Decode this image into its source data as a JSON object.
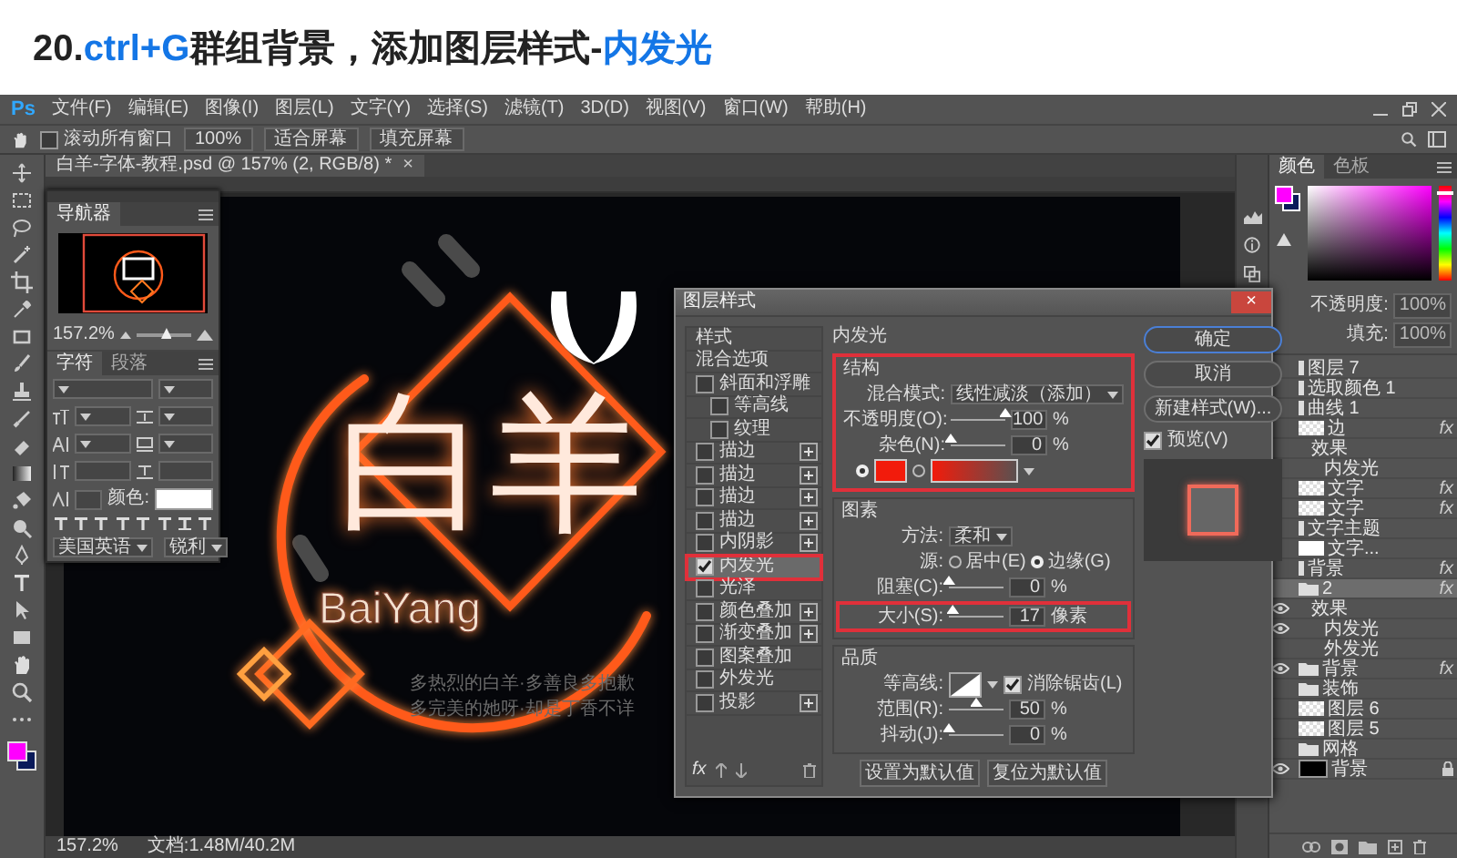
{
  "title": {
    "segments": [
      {
        "text": "20.",
        "highlight": false
      },
      {
        "text": "ctrl+G",
        "highlight": true
      },
      {
        "text": "群组背景，添加图层样式-",
        "highlight": false
      },
      {
        "text": "内发光",
        "highlight": true
      }
    ]
  },
  "app": {
    "logo": "Ps",
    "menu": [
      "文件(F)",
      "编辑(E)",
      "图像(I)",
      "图层(L)",
      "文字(Y)",
      "选择(S)",
      "滤镜(T)",
      "3D(D)",
      "视图(V)",
      "窗口(W)",
      "帮助(H)"
    ]
  },
  "options_bar": {
    "scroll_all": {
      "label": "滚动所有窗口",
      "checked": false
    },
    "buttons": [
      "100%",
      "适合屏幕",
      "填充屏幕"
    ]
  },
  "document": {
    "tab": "白羊-字体-教程.psd @ 157% (2, RGB/8) *",
    "close": "×",
    "artwork": {
      "title": "白羊",
      "subtitle": "BaiYang",
      "slogan": [
        "多热烈的白羊·多善良多抱歉",
        "多完美的她呀·却是丁香不详"
      ]
    },
    "status": {
      "zoom": "157.2%",
      "doc_size": "文档:1.48M/40.2M"
    }
  },
  "navigator": {
    "tabs": [
      {
        "label": "导航器",
        "selected": true
      }
    ],
    "zoom": "157.2%",
    "level": 0.55
  },
  "character": {
    "tabs": [
      {
        "label": "字符",
        "selected": true
      },
      {
        "label": "段落",
        "selected": false
      }
    ],
    "color_label": "颜色:",
    "language": "美国英语",
    "antialias": "锐利"
  },
  "color_panel": {
    "tabs": [
      {
        "label": "颜色",
        "selected": true
      },
      {
        "label": "色板",
        "selected": false
      }
    ],
    "hue": {
      "level": 0.08
    }
  },
  "layers_panel": {
    "opacity_label": "不透明度:",
    "opacity": "100%",
    "fill_label": "填充:",
    "fill": "100%",
    "layers": [
      {
        "name": "图层 7",
        "kind": "adjustment",
        "visible": false,
        "selected": false
      },
      {
        "name": "选取颜色 1",
        "kind": "adjustment",
        "visible": false,
        "selected": false
      },
      {
        "name": "曲线 1",
        "kind": "adjustment",
        "visible": false,
        "selected": false
      },
      {
        "name": "边",
        "kind": "layer",
        "visible": false,
        "selected": false,
        "badge": "fx",
        "children": [
          {
            "name": "效果",
            "visible": false,
            "selected": false,
            "children": [
              {
                "name": "内发光",
                "visible": false,
                "selected": false
              }
            ]
          }
        ]
      },
      {
        "name": "文字",
        "kind": "layer",
        "visible": false,
        "selected": false,
        "badge": "fx"
      },
      {
        "name": "文字",
        "kind": "layer",
        "visible": false,
        "selected": false,
        "badge": "fx"
      },
      {
        "name": "文字主题",
        "kind": "adjustment",
        "visible": false,
        "selected": false
      },
      {
        "name": "文字...",
        "kind": "mask",
        "visible": false,
        "selected": false
      },
      {
        "name": "背景",
        "kind": "adjustment",
        "visible": false,
        "selected": false,
        "badge": "fx"
      },
      {
        "name": "2",
        "kind": "folder",
        "visible": false,
        "selected": true,
        "badge": "fx",
        "children": [
          {
            "name": "效果",
            "visible": true,
            "selected": false,
            "children": [
              {
                "name": "内发光",
                "visible": true,
                "selected": false
              },
              {
                "name": "外发光",
                "visible": false,
                "selected": false
              }
            ]
          }
        ]
      },
      {
        "name": "背景",
        "kind": "folder",
        "visible": true,
        "selected": false,
        "badge": "fx"
      },
      {
        "name": "装饰",
        "kind": "folder",
        "visible": false,
        "selected": false
      },
      {
        "name": "图层 6",
        "kind": "layer",
        "visible": false,
        "selected": false
      },
      {
        "name": "图层 5",
        "kind": "layer",
        "visible": false,
        "selected": false
      },
      {
        "name": "网格",
        "kind": "folder",
        "visible": false,
        "selected": false
      },
      {
        "name": "背景",
        "kind": "fill",
        "visible": true,
        "selected": false,
        "locked": true
      }
    ]
  },
  "dialog": {
    "title": "图层样式",
    "close": "×",
    "styles": [
      {
        "label": "样式",
        "kind": "header",
        "selected": false
      },
      {
        "label": "混合选项",
        "kind": "header",
        "selected": false
      },
      {
        "label": "斜面和浮雕",
        "kind": "check",
        "checked": false,
        "selected": false,
        "children": [
          {
            "label": "等高线",
            "kind": "check",
            "checked": false,
            "selected": false
          },
          {
            "label": "纹理",
            "kind": "check",
            "checked": false,
            "selected": false
          }
        ]
      },
      {
        "label": "描边",
        "kind": "check",
        "checked": false,
        "selected": false,
        "add": true
      },
      {
        "label": "描边",
        "kind": "check",
        "checked": false,
        "selected": false,
        "add": true
      },
      {
        "label": "描边",
        "kind": "check",
        "checked": false,
        "selected": false,
        "add": true
      },
      {
        "label": "描边",
        "kind": "check",
        "checked": false,
        "selected": false,
        "add": true
      },
      {
        "label": "内阴影",
        "kind": "check",
        "checked": false,
        "selected": false,
        "add": true
      },
      {
        "label": "内发光",
        "kind": "check",
        "checked": true,
        "selected": true,
        "highlighted": true
      },
      {
        "label": "光泽",
        "kind": "check",
        "checked": false,
        "selected": false
      },
      {
        "label": "颜色叠加",
        "kind": "check",
        "checked": false,
        "selected": false,
        "add": true
      },
      {
        "label": "渐变叠加",
        "kind": "check",
        "checked": false,
        "selected": false,
        "add": true
      },
      {
        "label": "图案叠加",
        "kind": "check",
        "checked": false,
        "selected": false
      },
      {
        "label": "外发光",
        "kind": "check",
        "checked": false,
        "selected": false
      },
      {
        "label": "投影",
        "kind": "check",
        "checked": false,
        "selected": false,
        "add": true
      }
    ],
    "list_footer": "fx",
    "heading": "内发光",
    "sections": [
      {
        "title": "结构",
        "highlighted": true,
        "rows": [
          {
            "kind": "dropdown",
            "label": "混合模式:",
            "value": "线性减淡（添加）"
          },
          {
            "kind": "slider",
            "label": "不透明度(O):",
            "level": 1,
            "value": "100",
            "unit": "%"
          },
          {
            "kind": "slider",
            "label": "杂色(N):",
            "level": 0,
            "value": "0",
            "unit": "%"
          },
          {
            "kind": "swatches",
            "options": [
              {
                "kind": "color",
                "selected": true
              },
              {
                "kind": "gradient",
                "selected": false
              }
            ]
          }
        ]
      },
      {
        "title": "图素",
        "highlighted": false,
        "rows": [
          {
            "kind": "dropdown",
            "label": "方法:",
            "value": "柔和"
          },
          {
            "kind": "radio",
            "label": "源:",
            "options": [
              {
                "label": "居中(E)",
                "selected": false
              },
              {
                "label": "边缘(G)",
                "selected": true
              }
            ]
          },
          {
            "kind": "slider",
            "label": "阻塞(C):",
            "level": 0,
            "value": "0",
            "unit": "%"
          },
          {
            "kind": "slider",
            "label": "大小(S):",
            "level": 0.07,
            "value": "17",
            "unit": "像素",
            "highlighted": true
          }
        ]
      },
      {
        "title": "品质",
        "highlighted": false,
        "rows": [
          {
            "kind": "contour",
            "label": "等高线:",
            "check": {
              "label": "消除锯齿(L)",
              "checked": true
            }
          },
          {
            "kind": "slider",
            "label": "范围(R):",
            "level": 0.5,
            "value": "50",
            "unit": "%"
          },
          {
            "kind": "slider",
            "label": "抖动(J):",
            "level": 0,
            "value": "0",
            "unit": "%"
          }
        ]
      }
    ],
    "default_buttons": [
      "设置为默认值",
      "复位为默认值"
    ],
    "buttons": [
      {
        "label": "确定",
        "kind": "primary"
      },
      {
        "label": "取消",
        "kind": "normal"
      },
      {
        "label": "新建样式(W)...",
        "kind": "normal"
      }
    ],
    "preview": {
      "label": "预览(V)",
      "checked": true
    }
  }
}
